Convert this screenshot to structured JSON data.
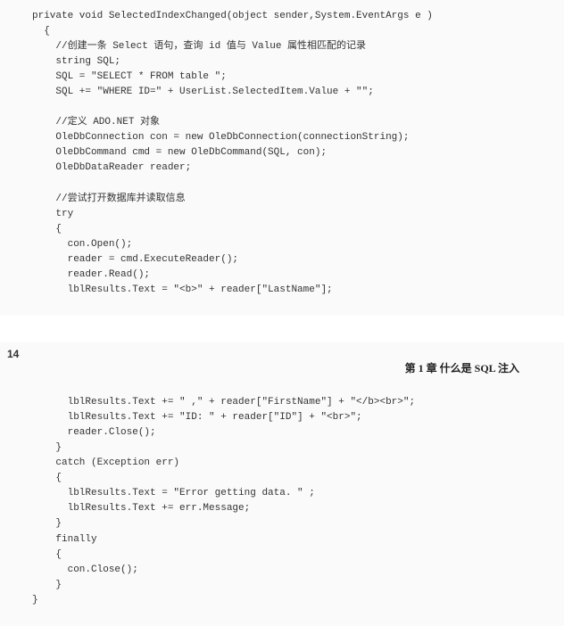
{
  "pageNumber": "14",
  "chapterHeader": "第 1 章  什么是 SQL 注入",
  "code": {
    "top": {
      "l1": "private void SelectedIndexChanged(object sender,System.EventArgs e )",
      "l2": "  {",
      "l3": "    //创建一条 Select 语句，查询 id 值与 Value 属性相匹配的记录",
      "l4": "    string SQL;",
      "l5": "    SQL = \"SELECT * FROM table \";",
      "l6": "    SQL += \"WHERE ID=\" + UserList.SelectedItem.Value + \"\";",
      "l7": "",
      "l8": "    //定义 ADO.NET 对象",
      "l9": "    OleDbConnection con = new OleDbConnection(connectionString);",
      "l10": "    OleDbCommand cmd = new OleDbCommand(SQL, con);",
      "l11": "    OleDbDataReader reader;",
      "l12": "",
      "l13": "    //尝试打开数据库并读取信息",
      "l14": "    try",
      "l15": "    {",
      "l16": "      con.Open();",
      "l17": "      reader = cmd.ExecuteReader();",
      "l18": "      reader.Read();",
      "l19": "      lblResults.Text = \"<b>\" + reader[\"LastName\"];"
    },
    "bottom": {
      "l1": "      lblResults.Text += \" ,\" + reader[\"FirstName\"] + \"</b><br>\";",
      "l2": "      lblResults.Text += \"ID: \" + reader[\"ID\"] + \"<br>\";",
      "l3": "      reader.Close();",
      "l4": "    }",
      "l5": "    catch (Exception err)",
      "l6": "    {",
      "l7": "      lblResults.Text = \"Error getting data. \" ;",
      "l8": "      lblResults.Text += err.Message;",
      "l9": "    }",
      "l10": "    finally",
      "l11": "    {",
      "l12": "      con.Close();",
      "l13": "    }",
      "l14": "}"
    }
  }
}
